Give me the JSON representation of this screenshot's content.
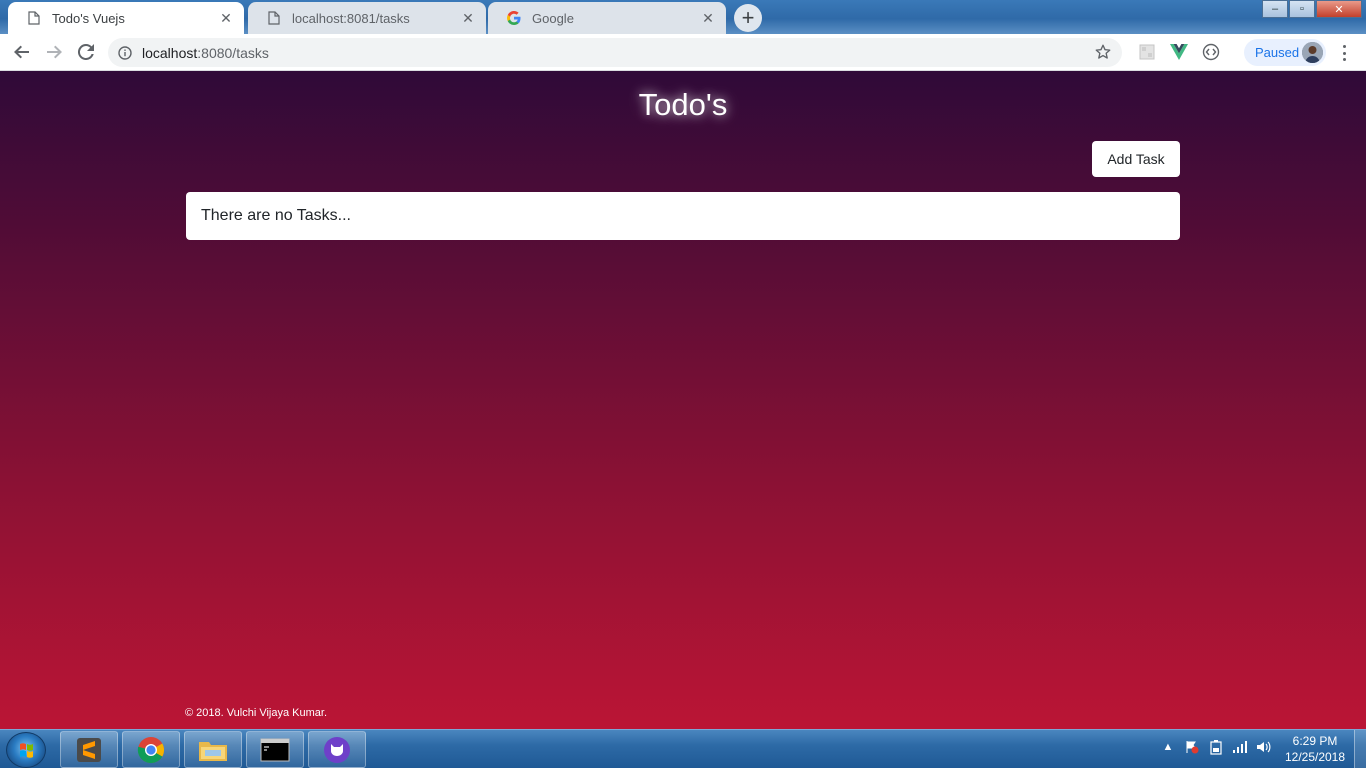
{
  "browser": {
    "tabs": [
      {
        "title": "Todo's Vuejs",
        "icon": "page-icon",
        "active": true
      },
      {
        "title": "localhost:8081/tasks",
        "icon": "page-icon",
        "active": false
      },
      {
        "title": "Google",
        "icon": "google-icon",
        "active": false
      }
    ],
    "new_tab_label": "+",
    "address": {
      "host": "localhost",
      "path": ":8080/tasks"
    },
    "profile_status": "Paused",
    "window_controls": {
      "minimize": "–",
      "maximize": "▫",
      "close": "✕"
    }
  },
  "app": {
    "title": "Todo's",
    "add_button_label": "Add Task",
    "empty_message": "There are no Tasks...",
    "footer": "© 2018. Vulchi Vijaya Kumar."
  },
  "taskbar": {
    "time": "6:29 PM",
    "date": "12/25/2018",
    "apps": [
      "sublime-text-icon",
      "chrome-icon",
      "file-explorer-icon",
      "command-prompt-icon",
      "github-desktop-icon"
    ]
  },
  "colors": {
    "background_top": "#2f0a38",
    "background_bottom": "#bb1535",
    "card": "#ffffff",
    "accent_link": "#1a73e8"
  }
}
